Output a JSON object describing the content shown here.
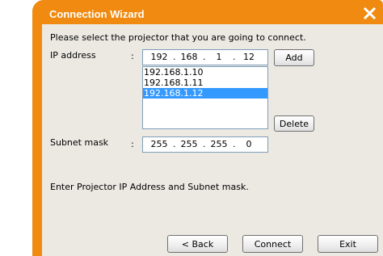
{
  "window": {
    "title": "Connection Wizard"
  },
  "instruction": "Please select the projector that you are going to connect.",
  "ip_address": {
    "label": "IP address",
    "colon": ":",
    "octets": [
      "192",
      "168",
      "1",
      "12"
    ]
  },
  "ip_list": {
    "items": [
      "192.168.1.10",
      "192.168.1.11",
      "192.168.1.12"
    ],
    "selected_index": 2
  },
  "subnet_mask": {
    "label": "Subnet mask",
    "colon": ":",
    "octets": [
      "255",
      "255",
      "255",
      "0"
    ]
  },
  "hint": "Enter Projector IP Address and Subnet mask.",
  "buttons": {
    "add": "Add",
    "delete": "Delete",
    "back": "< Back",
    "connect": "Connect",
    "exit": "Exit"
  },
  "colors": {
    "title_bar": "#f08a10",
    "client": "#ece9e3",
    "selection": "#3399ff"
  },
  "icons": {
    "close": "close-x-icon"
  }
}
